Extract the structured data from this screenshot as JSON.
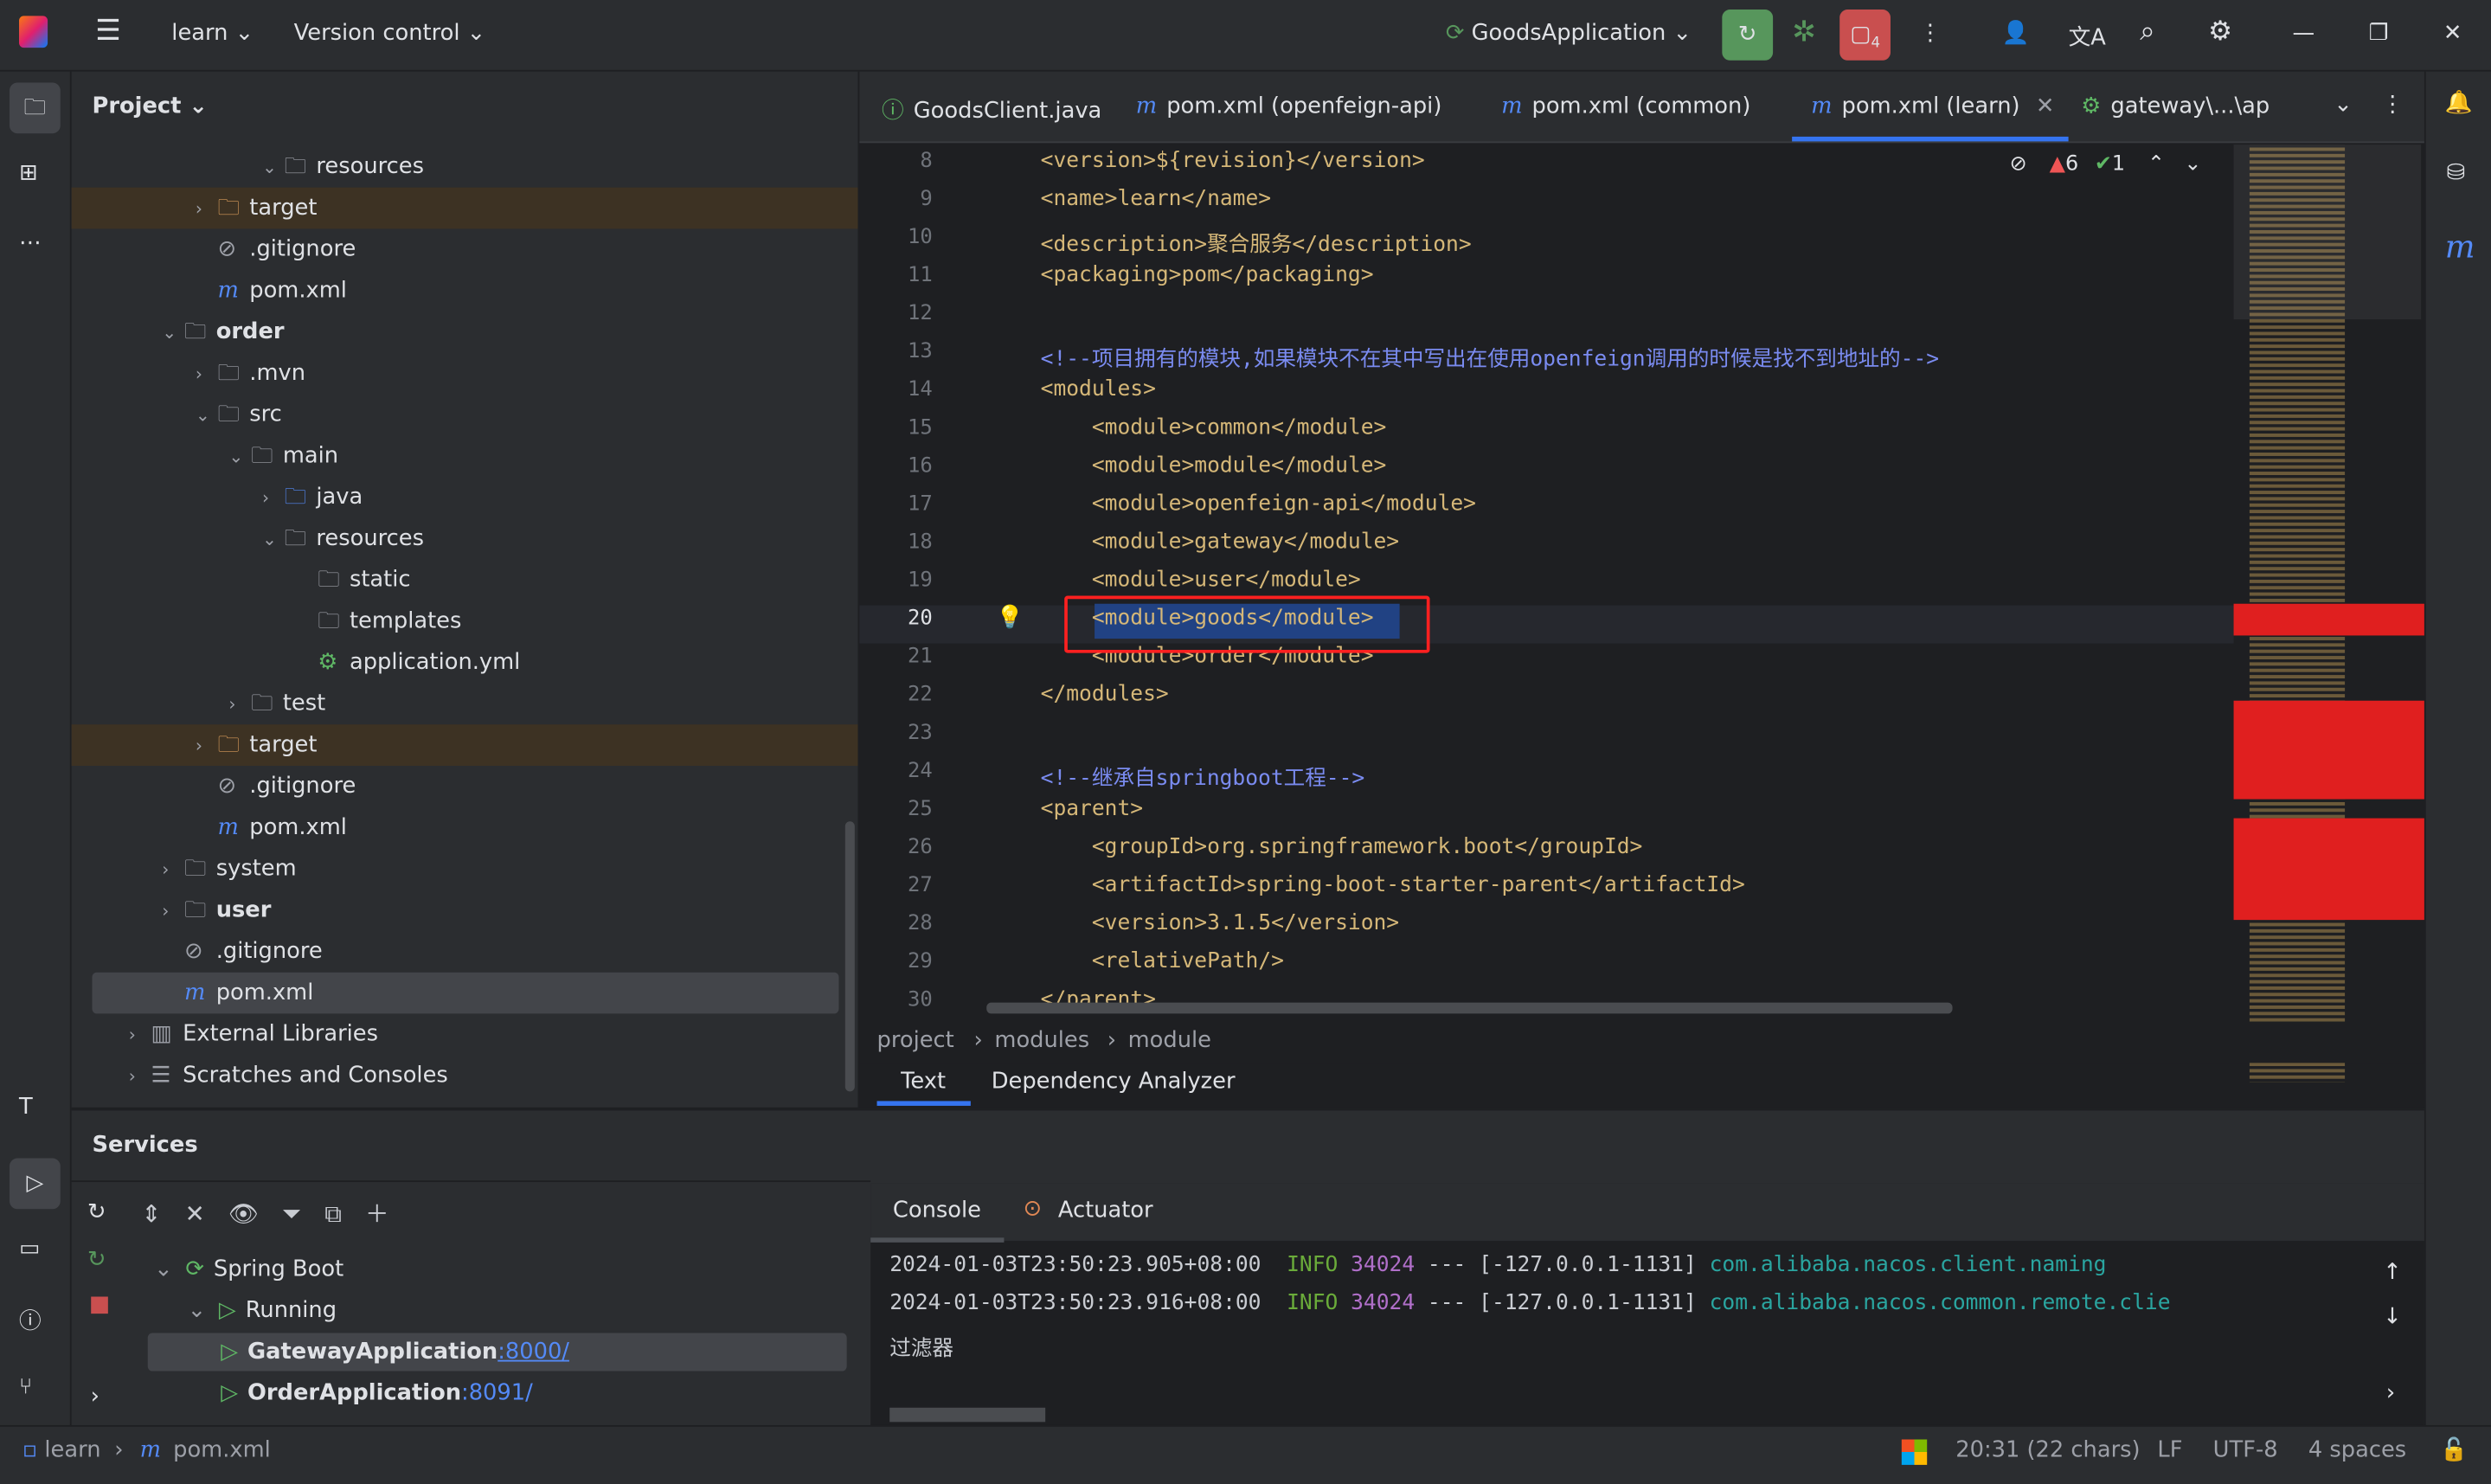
{
  "titlebar": {
    "project": "learn",
    "vcs": "Version control",
    "run_config": "GoodsApplication",
    "badge": "4"
  },
  "project_panel": {
    "title": "Project",
    "rows": [
      {
        "d": 5,
        "c": "v",
        "i": "folder-res",
        "l": "resources"
      },
      {
        "d": 3,
        "c": ">",
        "i": "folder-ex",
        "l": "target",
        "ex": true
      },
      {
        "d": 3,
        "c": "",
        "i": "ignore",
        "l": ".gitignore"
      },
      {
        "d": 3,
        "c": "",
        "i": "maven",
        "l": "pom.xml"
      },
      {
        "d": 2,
        "c": "v",
        "i": "module",
        "l": "order",
        "b": true
      },
      {
        "d": 3,
        "c": ">",
        "i": "folder",
        "l": ".mvn"
      },
      {
        "d": 3,
        "c": "v",
        "i": "folder",
        "l": "src"
      },
      {
        "d": 4,
        "c": "v",
        "i": "folder",
        "l": "main"
      },
      {
        "d": 5,
        "c": ">",
        "i": "folder-src",
        "l": "java"
      },
      {
        "d": 5,
        "c": "v",
        "i": "folder-res",
        "l": "resources"
      },
      {
        "d": 6,
        "c": "",
        "i": "folder",
        "l": "static"
      },
      {
        "d": 6,
        "c": "",
        "i": "folder",
        "l": "templates"
      },
      {
        "d": 6,
        "c": "",
        "i": "yaml",
        "l": "application.yml"
      },
      {
        "d": 4,
        "c": ">",
        "i": "folder",
        "l": "test"
      },
      {
        "d": 3,
        "c": ">",
        "i": "folder-ex",
        "l": "target",
        "ex": true
      },
      {
        "d": 3,
        "c": "",
        "i": "ignore",
        "l": ".gitignore"
      },
      {
        "d": 3,
        "c": "",
        "i": "maven",
        "l": "pom.xml"
      },
      {
        "d": 2,
        "c": ">",
        "i": "folder",
        "l": "system"
      },
      {
        "d": 2,
        "c": ">",
        "i": "module",
        "l": "user",
        "b": true
      },
      {
        "d": 2,
        "c": "",
        "i": "ignore",
        "l": ".gitignore"
      },
      {
        "d": 2,
        "c": "",
        "i": "maven",
        "l": "pom.xml",
        "sel": true
      },
      {
        "d": 1,
        "c": ">",
        "i": "library",
        "l": "External Libraries"
      },
      {
        "d": 1,
        "c": ">",
        "i": "scratch",
        "l": "Scratches and Consoles"
      }
    ]
  },
  "editor": {
    "tabs": [
      {
        "label": "GoodsClient.java",
        "icon": "java-interface"
      },
      {
        "label": "pom.xml (openfeign-api)",
        "icon": "maven"
      },
      {
        "label": "pom.xml (common)",
        "icon": "maven"
      },
      {
        "label": "pom.xml (learn)",
        "icon": "maven",
        "active": true
      },
      {
        "label": "gateway\\...\\ap",
        "icon": "yaml"
      }
    ],
    "inspections": {
      "errors": "6",
      "ok": "1"
    },
    "lines": [
      {
        "n": "8",
        "t": "<version>${revision}</version>"
      },
      {
        "n": "9",
        "t": "<name>learn</name>"
      },
      {
        "n": "10",
        "t": "<description>聚合服务</description>"
      },
      {
        "n": "11",
        "t": "<packaging>pom</packaging>"
      },
      {
        "n": "12",
        "t": ""
      },
      {
        "n": "13",
        "t": "<!--项目拥有的模块,如果模块不在其中写出在使用openfeign调用的时候是找不到地址的-->",
        "cm": true
      },
      {
        "n": "14",
        "t": "<modules>"
      },
      {
        "n": "15",
        "t": "    <module>common</module>"
      },
      {
        "n": "16",
        "t": "    <module>module</module>"
      },
      {
        "n": "17",
        "t": "    <module>openfeign-api</module>"
      },
      {
        "n": "18",
        "t": "    <module>gateway</module>"
      },
      {
        "n": "19",
        "t": "    <module>user</module>"
      },
      {
        "n": "20",
        "t": "    <module>goods</module>"
      },
      {
        "n": "21",
        "t": "    <module>order</module>"
      },
      {
        "n": "22",
        "t": "</modules>"
      },
      {
        "n": "23",
        "t": ""
      },
      {
        "n": "24",
        "t": "<!--继承自springboot工程-->",
        "cm": true
      },
      {
        "n": "25",
        "t": "<parent>"
      },
      {
        "n": "26",
        "t": "    <groupId>org.springframework.boot</groupId>"
      },
      {
        "n": "27",
        "t": "    <artifactId>spring-boot-starter-parent</artifactId>"
      },
      {
        "n": "28",
        "t": "    <version>3.1.5</version>"
      },
      {
        "n": "29",
        "t": "    <relativePath/>"
      },
      {
        "n": "30",
        "t": "</parent>"
      }
    ],
    "breadcrumb": [
      "project",
      "modules",
      "module"
    ],
    "bottom_tabs": [
      "Text",
      "Dependency Analyzer"
    ]
  },
  "services": {
    "title": "Services",
    "tree": [
      {
        "d": 0,
        "l": "Spring Boot"
      },
      {
        "d": 1,
        "l": "Running"
      },
      {
        "d": 2,
        "l": "GatewayApplication",
        "port": ":8000/",
        "sel": true
      },
      {
        "d": 2,
        "l": "OrderApplication",
        "port": ":8091/"
      }
    ],
    "console_tabs": [
      "Console",
      "Actuator"
    ],
    "log": [
      {
        "ts": "2024-01-03T23:50:23.905+08:00",
        "lvl": "INFO",
        "pid": "34024",
        "sep": "---",
        "th": "[-127.0.0.1-1131]",
        "cls": "com.alibaba.nacos.client.naming"
      },
      {
        "ts": "2024-01-03T23:50:23.916+08:00",
        "lvl": "INFO",
        "pid": "34024",
        "sep": "---",
        "th": "[-127.0.0.1-1131]",
        "cls": "com.alibaba.nacos.common.remote.clie"
      }
    ],
    "extra": "过滤器"
  },
  "statusbar": {
    "path": [
      "learn",
      "pom.xml"
    ],
    "pos": "20:31 (22 chars)",
    "le": "LF",
    "enc": "UTF-8",
    "indent": "4 spaces"
  },
  "colors": {
    "accent": "#3574f0",
    "run": "#57965c",
    "stop": "#c94f4f",
    "selection": "#214283",
    "highlight_box": "#ff2020"
  }
}
